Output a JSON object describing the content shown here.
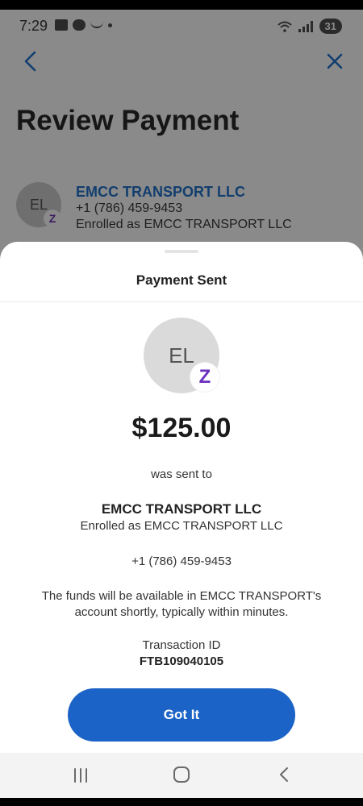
{
  "status_bar": {
    "time": "7:29",
    "battery": "31"
  },
  "header": {
    "title": "Review Payment"
  },
  "payee": {
    "initials": "EL",
    "badge": "Z",
    "name": "EMCC TRANSPORT LLC",
    "phone": "+1 (786) 459-9453",
    "enrolled": "Enrolled as EMCC TRANSPORT LLC"
  },
  "sheet": {
    "title": "Payment Sent",
    "avatar_initials": "EL",
    "badge": "Z",
    "amount": "$125.00",
    "sent_to_label": "was sent to",
    "recipient_name": "EMCC TRANSPORT LLC",
    "recipient_enrolled": "Enrolled as EMCC TRANSPORT LLC",
    "recipient_phone": "+1 (786) 459-9453",
    "funds_note": "The funds will be available in EMCC TRANSPORT's account shortly, typically within minutes.",
    "transaction_label": "Transaction ID",
    "transaction_id": "FTB109040105",
    "button_label": "Got It"
  },
  "colors": {
    "primary_button": "#1b63c6",
    "link_blue": "#123e6e",
    "zelle_purple": "#6b2fc0",
    "overlay_gray": "#8a8a8a"
  },
  "icons": {
    "back": "chevron-left-icon",
    "close": "close-icon",
    "zelle": "zelle-icon",
    "nav_recents": "recents-icon",
    "nav_home": "home-icon",
    "nav_back": "back-icon"
  }
}
